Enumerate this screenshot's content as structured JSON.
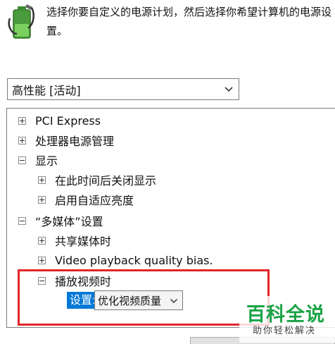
{
  "header": {
    "icon": "power-plan-battery-icon",
    "description": "选择你要自定义的电源计划，然后选择你希望计算机的电源设置。"
  },
  "plan_select": {
    "value": "高性能 [活动]",
    "icon": "chevron-down-icon"
  },
  "tree": {
    "items": [
      {
        "label": "PCI Express",
        "state": "collapsed"
      },
      {
        "label": "处理器电源管理",
        "state": "collapsed"
      },
      {
        "label": "显示",
        "state": "expanded"
      },
      {
        "label": "在此时间后关闭显示",
        "state": "collapsed"
      },
      {
        "label": "启用自适应亮度",
        "state": "collapsed"
      },
      {
        "label": "“多媒体”设置",
        "state": "expanded"
      },
      {
        "label": "共享媒体时",
        "state": "collapsed"
      },
      {
        "label": "Video playback quality bias.",
        "state": "collapsed"
      },
      {
        "label": "播放视频时",
        "state": "expanded"
      }
    ],
    "setting": {
      "label": "设置:",
      "value": "优化视频质量"
    }
  },
  "watermark": {
    "title": "百科全说",
    "subtitle": "助你轻松解决"
  },
  "colors": {
    "accent": "#0078d7",
    "highlight": "#e2252b",
    "watermark_green": "#1aa346"
  }
}
